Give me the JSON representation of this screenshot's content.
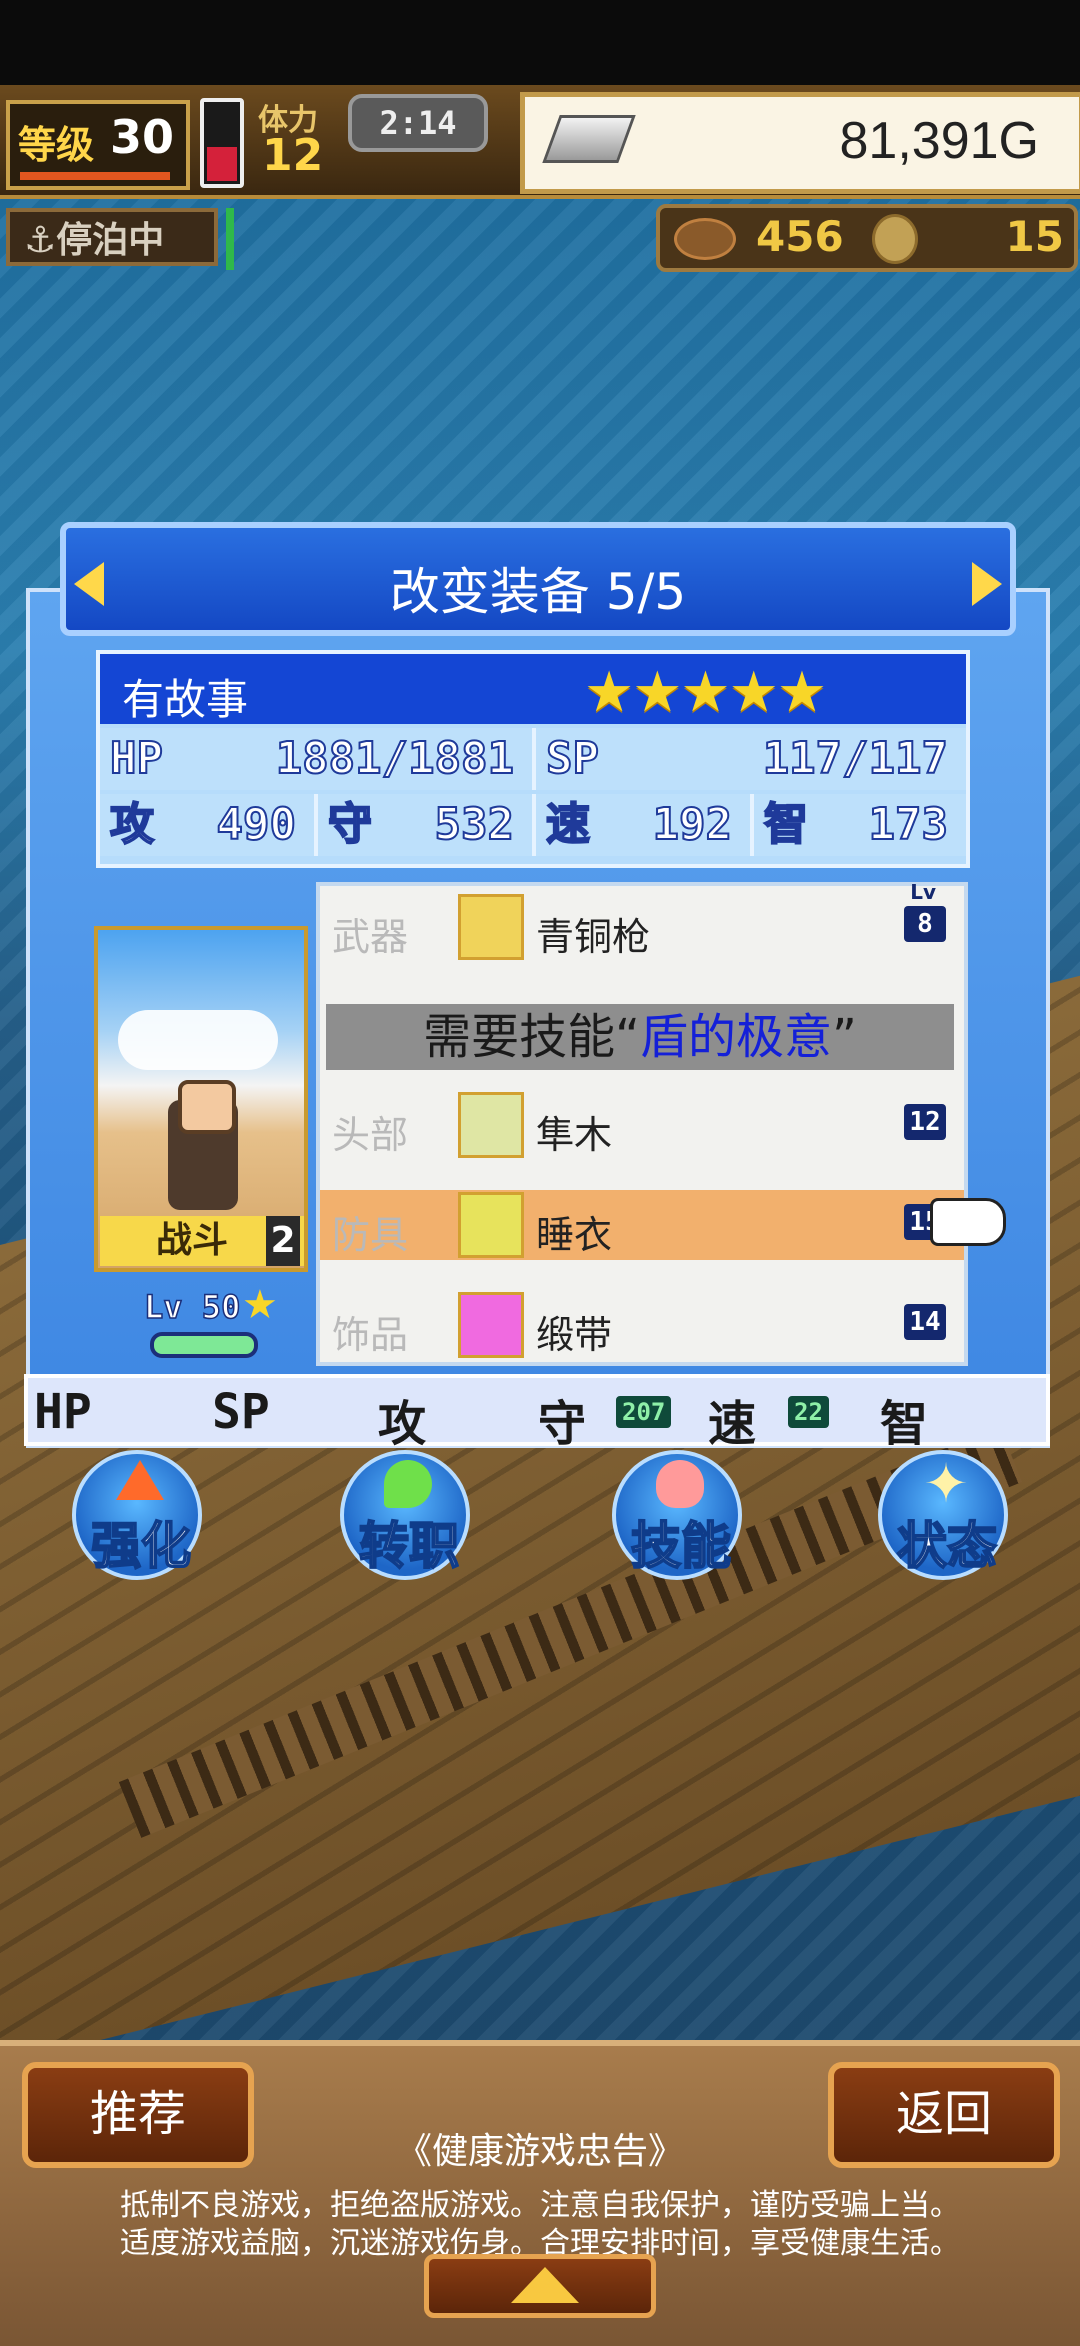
{
  "hud": {
    "level_label": "等级",
    "level_value": "30",
    "battery_level": 0.45,
    "stamina_label": "体力",
    "stamina_value": "12",
    "clock": "2:14",
    "gold": "81,391G",
    "docked_label": "停泊中",
    "resource1": "456",
    "resource2": "15"
  },
  "dialog": {
    "title": "改变装备 5/5",
    "character": {
      "name": "有故事",
      "stars": "★★★★★",
      "hp_label": "HP",
      "hp": "1881/1881",
      "sp_label": "SP",
      "sp": "117/117",
      "atk_label": "攻",
      "atk": "490",
      "def_label": "守",
      "def": "532",
      "spd_label": "速",
      "spd": "192",
      "int_label": "智",
      "int": "173",
      "job": "战斗",
      "job_rank": "2",
      "lv": "Lv 50"
    },
    "equipment": {
      "lv_header": "Lv",
      "weapon_label": "武器",
      "weapon_name": "青铜枪",
      "weapon_lv": "8",
      "requirement_prefix": "需要技能“",
      "requirement_skill": "盾的极意",
      "requirement_suffix": "”",
      "head_label": "头部",
      "head_name": "隼木",
      "head_lv": "12",
      "armor_label": "防具",
      "armor_name": "睡衣",
      "armor_lv": "15",
      "accessory_label": "饰品",
      "accessory_name": "缎带",
      "accessory_lv": "14"
    },
    "changes": {
      "hp": "HP",
      "sp": "SP",
      "atk": "攻",
      "def": "守",
      "def_val": "207",
      "spd": "速",
      "spd_val": "22",
      "int": "智"
    }
  },
  "actions": {
    "enhance": "强化",
    "job_change": "转职",
    "skill": "技能",
    "status": "状态"
  },
  "footer": {
    "recommend": "推荐",
    "back": "返回",
    "advisory_title": "《健康游戏忠告》",
    "advisory_line1": "抵制不良游戏，拒绝盗版游戏。注意自我保护，谨防受骗上当。",
    "advisory_line2": "适度游戏益脑，沉迷游戏伤身。合理安排时间，享受健康生活。"
  },
  "colors": {
    "accent_blue": "#1446d4",
    "selected_row": "#f2b06d",
    "skill_text": "#1420d8"
  }
}
